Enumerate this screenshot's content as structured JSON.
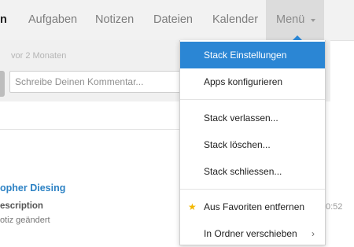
{
  "nav": {
    "tabs": [
      {
        "label": "n"
      },
      {
        "label": "Aufgaben"
      },
      {
        "label": "Notizen"
      },
      {
        "label": "Dateien"
      },
      {
        "label": "Kalender"
      },
      {
        "label": "Menü"
      }
    ]
  },
  "comment": {
    "timestamp": "vor 2 Monaten",
    "placeholder": "Schreibe Deinen Kommentar..."
  },
  "activity": {
    "author": "opher Diesing",
    "title": "escription",
    "subtitle": "otiz geändert",
    "time": "0:52"
  },
  "menu": {
    "items": [
      {
        "label": "Stack Einstellungen"
      },
      {
        "label": "Apps konfigurieren"
      },
      {
        "label": "Stack verlassen..."
      },
      {
        "label": "Stack löschen..."
      },
      {
        "label": "Stack schliessen..."
      },
      {
        "label": "Aus Favoriten entfernen",
        "icon": "star-icon"
      },
      {
        "label": "In Ordner verschieben",
        "icon": "chevron-right-icon"
      }
    ],
    "highlight_color": "#2b86d4",
    "star_color": "#f3b700"
  }
}
